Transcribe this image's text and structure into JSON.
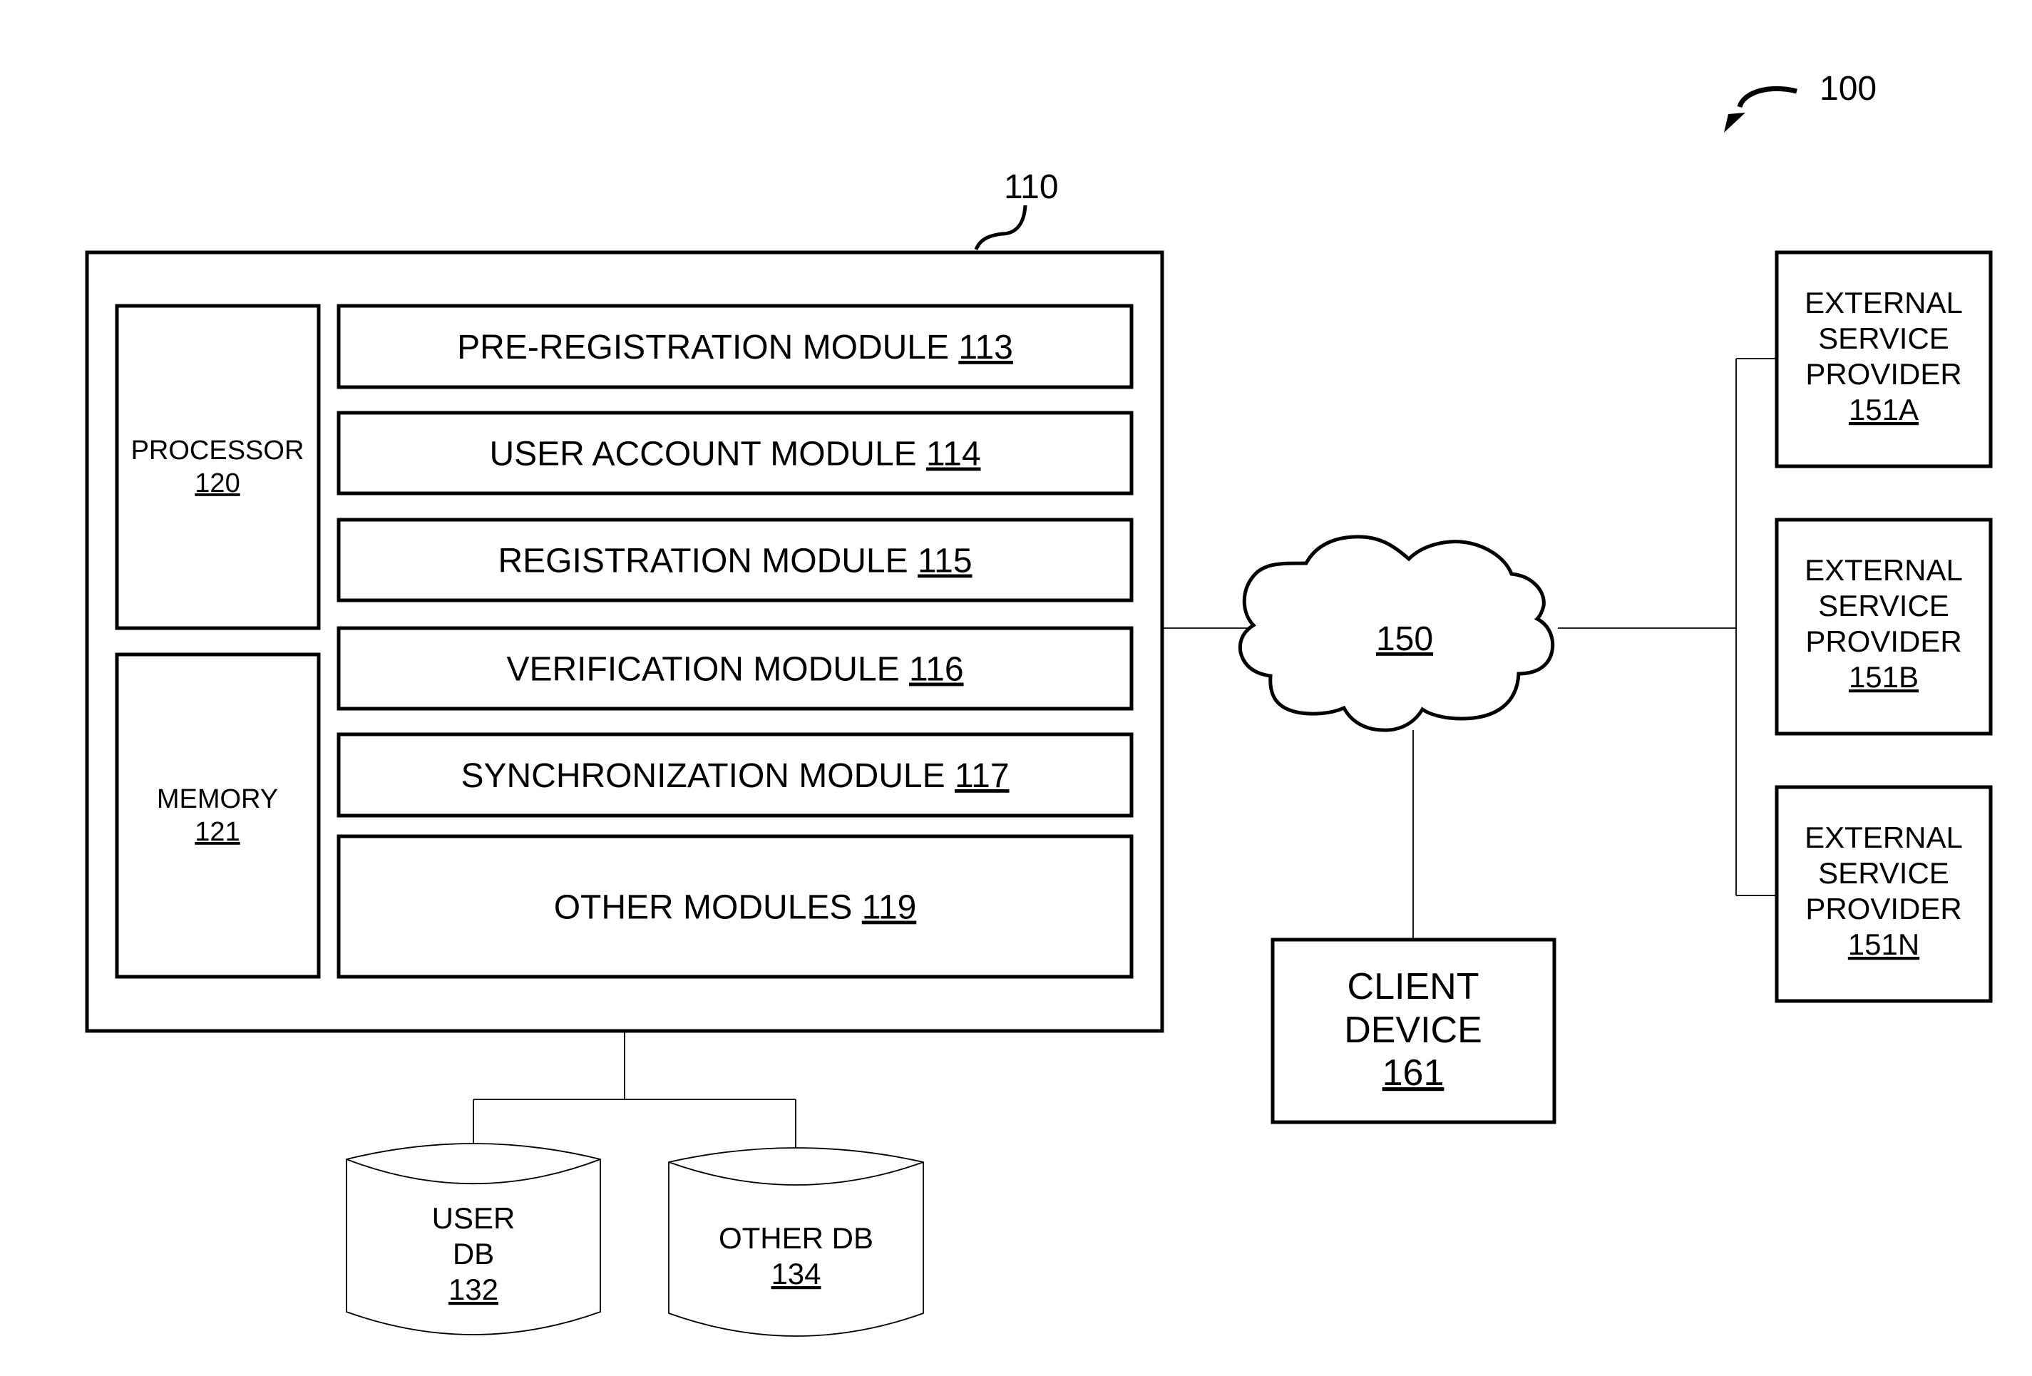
{
  "figure": {
    "ref": "100"
  },
  "server": {
    "ref": "110",
    "processor": {
      "label": "PROCESSOR",
      "ref": "120"
    },
    "memory": {
      "label": "MEMORY",
      "ref": "121"
    },
    "modules": [
      {
        "label": "PRE-REGISTRATION MODULE",
        "ref": "113"
      },
      {
        "label": "USER ACCOUNT MODULE",
        "ref": "114"
      },
      {
        "label": "REGISTRATION MODULE",
        "ref": "115"
      },
      {
        "label": "VERIFICATION MODULE",
        "ref": "116"
      },
      {
        "label": "SYNCHRONIZATION MODULE",
        "ref": "117"
      },
      {
        "label": "OTHER MODULES",
        "ref": "119"
      }
    ]
  },
  "databases": [
    {
      "lines": [
        "USER",
        "DB"
      ],
      "ref": "132"
    },
    {
      "lines": [
        "OTHER DB"
      ],
      "ref": "134"
    }
  ],
  "network": {
    "ref": "150"
  },
  "client": {
    "lines": [
      "CLIENT",
      "DEVICE"
    ],
    "ref": "161"
  },
  "providers": [
    {
      "lines": [
        "EXTERNAL",
        "SERVICE",
        "PROVIDER"
      ],
      "ref": "151A"
    },
    {
      "lines": [
        "EXTERNAL",
        "SERVICE",
        "PROVIDER"
      ],
      "ref": "151B"
    },
    {
      "lines": [
        "EXTERNAL",
        "SERVICE",
        "PROVIDER"
      ],
      "ref": "151N"
    }
  ]
}
